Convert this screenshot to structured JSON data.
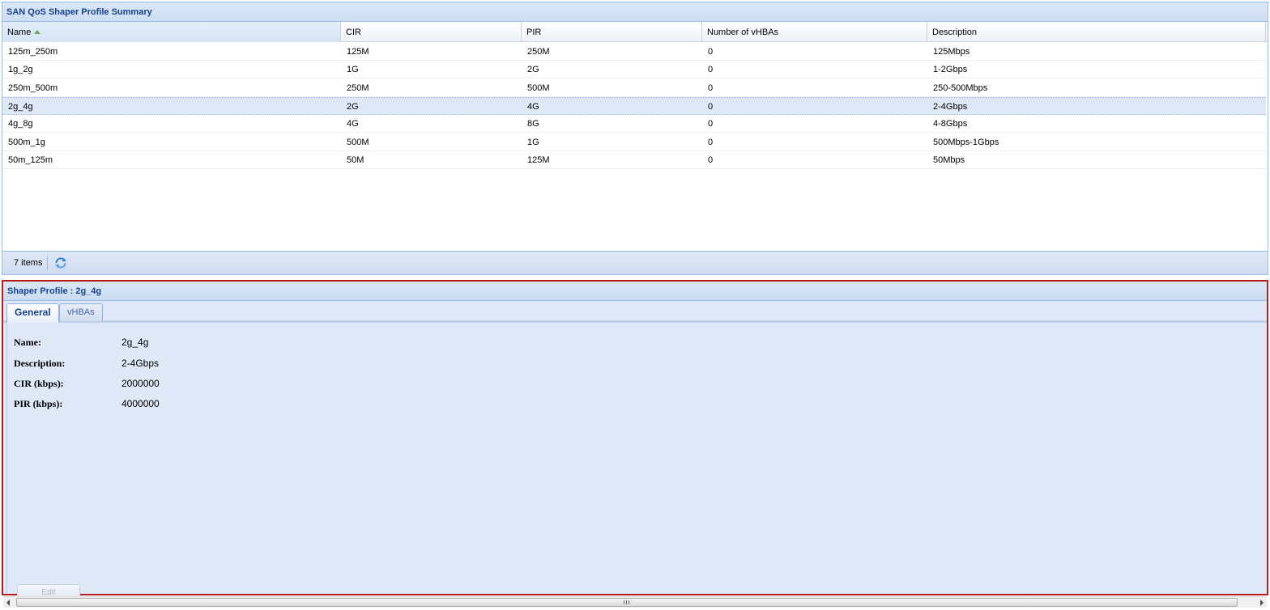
{
  "summary": {
    "title": "SAN QoS Shaper Profile Summary",
    "columns": [
      "Name",
      "CIR",
      "PIR",
      "Number of vHBAs",
      "Description"
    ],
    "sort_column": "Name",
    "sort_direction": "ascending",
    "rows": [
      [
        "125m_250m",
        "125M",
        "250M",
        "0",
        "125Mbps"
      ],
      [
        "1g_2g",
        "1G",
        "2G",
        "0",
        "1-2Gbps"
      ],
      [
        "250m_500m",
        "250M",
        "500M",
        "0",
        "250-500Mbps"
      ],
      [
        "2g_4g",
        "2G",
        "4G",
        "0",
        "2-4Gbps"
      ],
      [
        "4g_8g",
        "4G",
        "8G",
        "0",
        "4-8Gbps"
      ],
      [
        "500m_1g",
        "500M",
        "1G",
        "0",
        "500Mbps-1Gbps"
      ],
      [
        "50m_125m",
        "50M",
        "125M",
        "0",
        "50Mbps"
      ]
    ],
    "selected_row": "2g_4g",
    "toolbar": {
      "items_count": "7 items",
      "refresh_icon": "refresh-icon"
    }
  },
  "detail": {
    "title": "Shaper Profile : 2g_4g",
    "tabs": [
      {
        "label": "General",
        "active": true
      },
      {
        "label": "vHBAs",
        "active": false
      }
    ],
    "fields": [
      {
        "label": "Name:",
        "value": "2g_4g"
      },
      {
        "label": "Description:",
        "value": "2-4Gbps"
      },
      {
        "label": "CIR (kbps):",
        "value": "2000000"
      },
      {
        "label": "PIR (kbps):",
        "value": "4000000"
      }
    ],
    "edit_label": "Edit"
  },
  "colors": {
    "header_text": "#15428b",
    "selection_bg": "#dfe8f6",
    "detail_bg": "#dfe8f6",
    "highlight_border": "#b71c1c"
  }
}
